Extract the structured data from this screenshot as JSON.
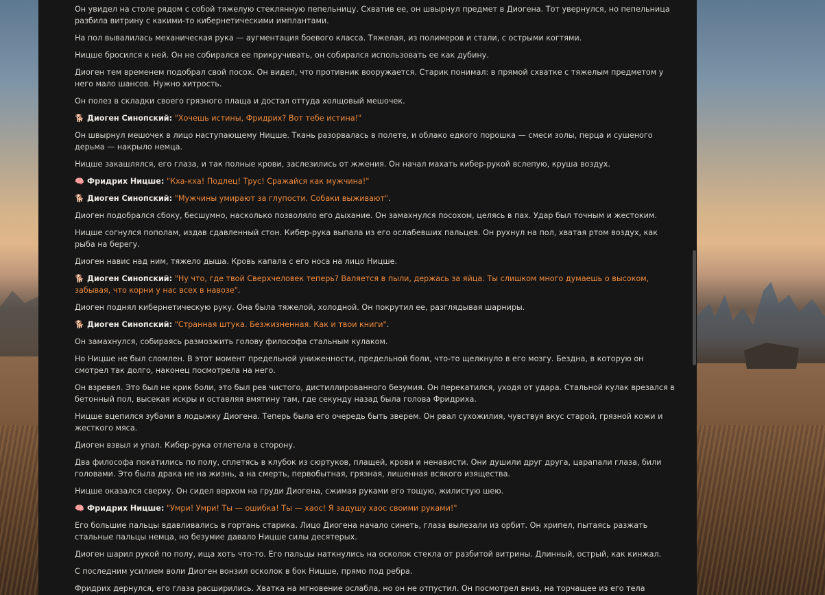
{
  "colors": {
    "panel_bg": "#161616",
    "text": "#d9d6d1",
    "speaker": "#ece8e2",
    "quote": "#ef8a3c"
  },
  "messages": [
    {
      "type": "narration",
      "text": "Он увидел на столе рядом с собой тяжелую стеклянную пепельницу. Схватив ее, он швырнул предмет в Диогена. Тот увернулся, но пепельница разбила витрину с какими-то кибернетическими имплантами."
    },
    {
      "type": "narration",
      "text": "На пол вывалилась механическая рука — аугментация боевого класса. Тяжелая, из полимеров и стали, с острыми когтями."
    },
    {
      "type": "narration",
      "text": "Ницше бросился к ней. Он не собирался ее прикручивать, он собирался использовать ее как дубину."
    },
    {
      "type": "narration",
      "text": "Диоген тем временем подобрал свой посох. Он видел, что противник вооружается. Старик понимал: в прямой схватке с тяжелым предметом у него мало шансов. Нужно хитрость."
    },
    {
      "type": "narration",
      "text": "Он полез в складки своего грязного плаща и достал оттуда холщовый мешочек."
    },
    {
      "type": "dialogue",
      "icon": "dog-icon",
      "glyph": "🐕",
      "speaker": "Диоген Синопский:",
      "quote": "\"Хочешь истины, Фридрих? Вот тебе истина!\"",
      "tail": ""
    },
    {
      "type": "narration",
      "text": "Он швырнул мешочек в лицо наступающему Ницше. Ткань разорвалась в полете, и облако едкого порошка — смеси золы, перца и сушеного дерьма — накрыло немца."
    },
    {
      "type": "narration",
      "text": "Ницше закашлялся, его глаза, и так полные крови, заслезились от жжения. Он начал махать кибер-рукой вслепую, круша воздух."
    },
    {
      "type": "dialogue",
      "icon": "brain-icon",
      "glyph": "🧠",
      "speaker": "Фридрих Ницше:",
      "quote": "\"Кха-кха! Подлец! Трус! Сражайся как мужчина!\"",
      "tail": ""
    },
    {
      "type": "dialogue",
      "icon": "dog-icon",
      "glyph": "🐕",
      "speaker": "Диоген Синопский:",
      "quote": "\"Мужчины умирают за глупости. Собаки выживают\"",
      "tail": "."
    },
    {
      "type": "narration",
      "text": "Диоген подобрался сбоку, бесшумно, насколько позволяло его дыхание. Он замахнулся посохом, целясь в пах. Удар был точным и жестоким."
    },
    {
      "type": "narration",
      "text": "Ницше согнулся пополам, издав сдавленный стон. Кибер-рука выпала из его ослабевших пальцев. Он рухнул на пол, хватая ртом воздух, как рыба на берегу."
    },
    {
      "type": "narration",
      "text": "Диоген навис над ним, тяжело дыша. Кровь капала с его носа на лицо Ницше."
    },
    {
      "type": "dialogue",
      "icon": "dog-icon",
      "glyph": "🐕",
      "speaker": "Диоген Синопский:",
      "quote": "\"Ну что, где твой Сверхчеловек теперь? Валяется в пыли, держась за яйца. Ты слишком много думаешь о высоком, забывая, что корни у нас всех в навозе\"",
      "tail": "."
    },
    {
      "type": "narration",
      "text": "Диоген поднял кибернетическую руку. Она была тяжелой, холодной. Он покрутил ее, разглядывая шарниры."
    },
    {
      "type": "dialogue",
      "icon": "dog-icon",
      "glyph": "🐕",
      "speaker": "Диоген Синопский:",
      "quote": "\"Странная штука. Безжизненная. Как и твои книги\"",
      "tail": "."
    },
    {
      "type": "narration",
      "text": "Он замахнулся, собираясь размозжить голову философа стальным кулаком."
    },
    {
      "type": "narration",
      "text": "Но Ницше не был сломлен. В этот момент предельной униженности, предельной боли, что-то щелкнуло в его мозгу. Бездна, в которую он смотрел так долго, наконец посмотрела на него."
    },
    {
      "type": "narration",
      "text": "Он взревел. Это был не крик боли, это был рев чистого, дистиллированного безумия. Он перекатился, уходя от удара. Стальной кулак врезался в бетонный пол, высекая искры и оставляя вмятину там, где секунду назад была голова Фридриха."
    },
    {
      "type": "narration",
      "text": "Ницше вцепился зубами в лодыжку Диогена. Теперь была его очередь быть зверем. Он рвал сухожилия, чувствуя вкус старой, грязной кожи и жесткого мяса."
    },
    {
      "type": "narration",
      "text": "Диоген взвыл и упал. Кибер-рука отлетела в сторону."
    },
    {
      "type": "narration",
      "text": "Два философа покатились по полу, сплетясь в клубок из сюртуков, плащей, крови и ненависти. Они душили друг друга, царапали глаза, били головами. Это была драка не на жизнь, а на смерть, первобытная, грязная, лишенная всякого изящества."
    },
    {
      "type": "narration",
      "text": "Ницше оказался сверху. Он сидел верхом на груди Диогена, сжимая руками его тощую, жилистую шею."
    },
    {
      "type": "dialogue",
      "icon": "brain-icon",
      "glyph": "🧠",
      "speaker": "Фридрих Ницше:",
      "quote": "\"Умри! Умри! Ты — ошибка! Ты — хаос! Я задушу хаос своими руками!\"",
      "tail": ""
    },
    {
      "type": "narration",
      "text": "Его большие пальцы вдавливались в гортань старика. Лицо Диогена начало синеть, глаза вылезали из орбит. Он хрипел, пытаясь разжать стальные пальцы немца, но безумие давало Ницше силы десятерых."
    },
    {
      "type": "narration",
      "text": "Диоген шарил рукой по полу, ища хоть что-то. Его пальцы наткнулись на осколок стекла от разбитой витрины. Длинный, острый, как кинжал."
    },
    {
      "type": "narration",
      "text": "С последним усилием воли Диоген вонзил осколок в бок Ницше, прямо под ребра."
    },
    {
      "type": "narration",
      "text": "Фридрих дернулся, его глаза расширились. Хватка на мгновение ослабла, но он не отпустил. Он посмотрел вниз, на торчащее из его тела стекло, из-под"
    }
  ]
}
